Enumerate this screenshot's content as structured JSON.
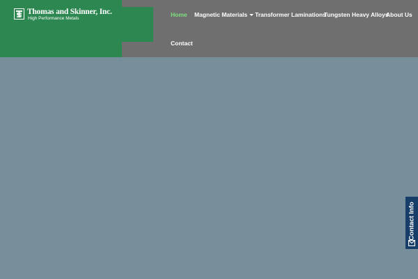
{
  "brand": {
    "name": "Thomas and Skinner, Inc.",
    "tagline": "High Performance Metals",
    "emblem_letters": "TS"
  },
  "nav": {
    "items": [
      {
        "label": "Home",
        "active": true
      },
      {
        "label": "Magnetic Materials",
        "has_dropdown": true
      },
      {
        "label": "Transformer Laminations"
      },
      {
        "label": "Tungsten Heavy Alloys"
      },
      {
        "label": "About Us"
      },
      {
        "label": "Contact"
      }
    ]
  },
  "contact_tab": {
    "label": "Contact Info",
    "icon": "envelope-icon"
  },
  "colors": {
    "header_bg": "#6f6f6f",
    "logo_bg": "#2c8750",
    "page_bg": "#778f9a",
    "active_nav": "#7ee07e",
    "contact_tab_bg": "#173e69"
  }
}
